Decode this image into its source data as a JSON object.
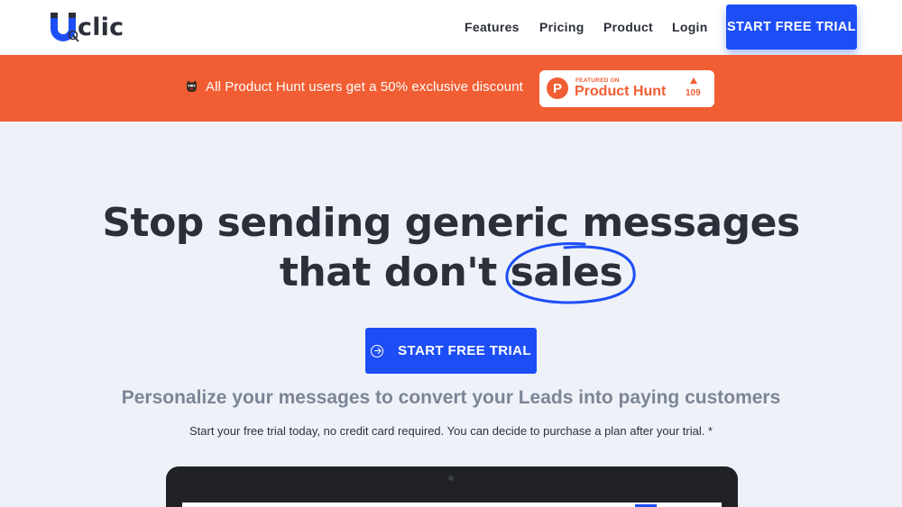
{
  "brand": {
    "name": "clic",
    "logo_letter": "U",
    "accent_color": "#1d4ef5",
    "promo_color": "#f25e33"
  },
  "nav": {
    "items": [
      {
        "label": "Features"
      },
      {
        "label": "Pricing"
      },
      {
        "label": "Product"
      },
      {
        "label": "Login"
      }
    ],
    "cta_label": "START FREE TRIAL"
  },
  "promo": {
    "text": "All Product Hunt users get a 50% exclusive discount",
    "badge": {
      "featured_on": "FEATURED ON",
      "name": "Product Hunt",
      "logo_letter": "P",
      "upvotes": "109"
    }
  },
  "hero": {
    "headline_line1": "Stop sending generic messages",
    "headline_line2_prefix": "that don't",
    "headline_circled_word": "sales",
    "cta_label": "START FREE TRIAL",
    "subtitle": "Personalize your messages to convert your Leads into paying customers",
    "note": "Start your free trial today, no credit card required. You can decide to purchase a plan after your trial. *"
  }
}
